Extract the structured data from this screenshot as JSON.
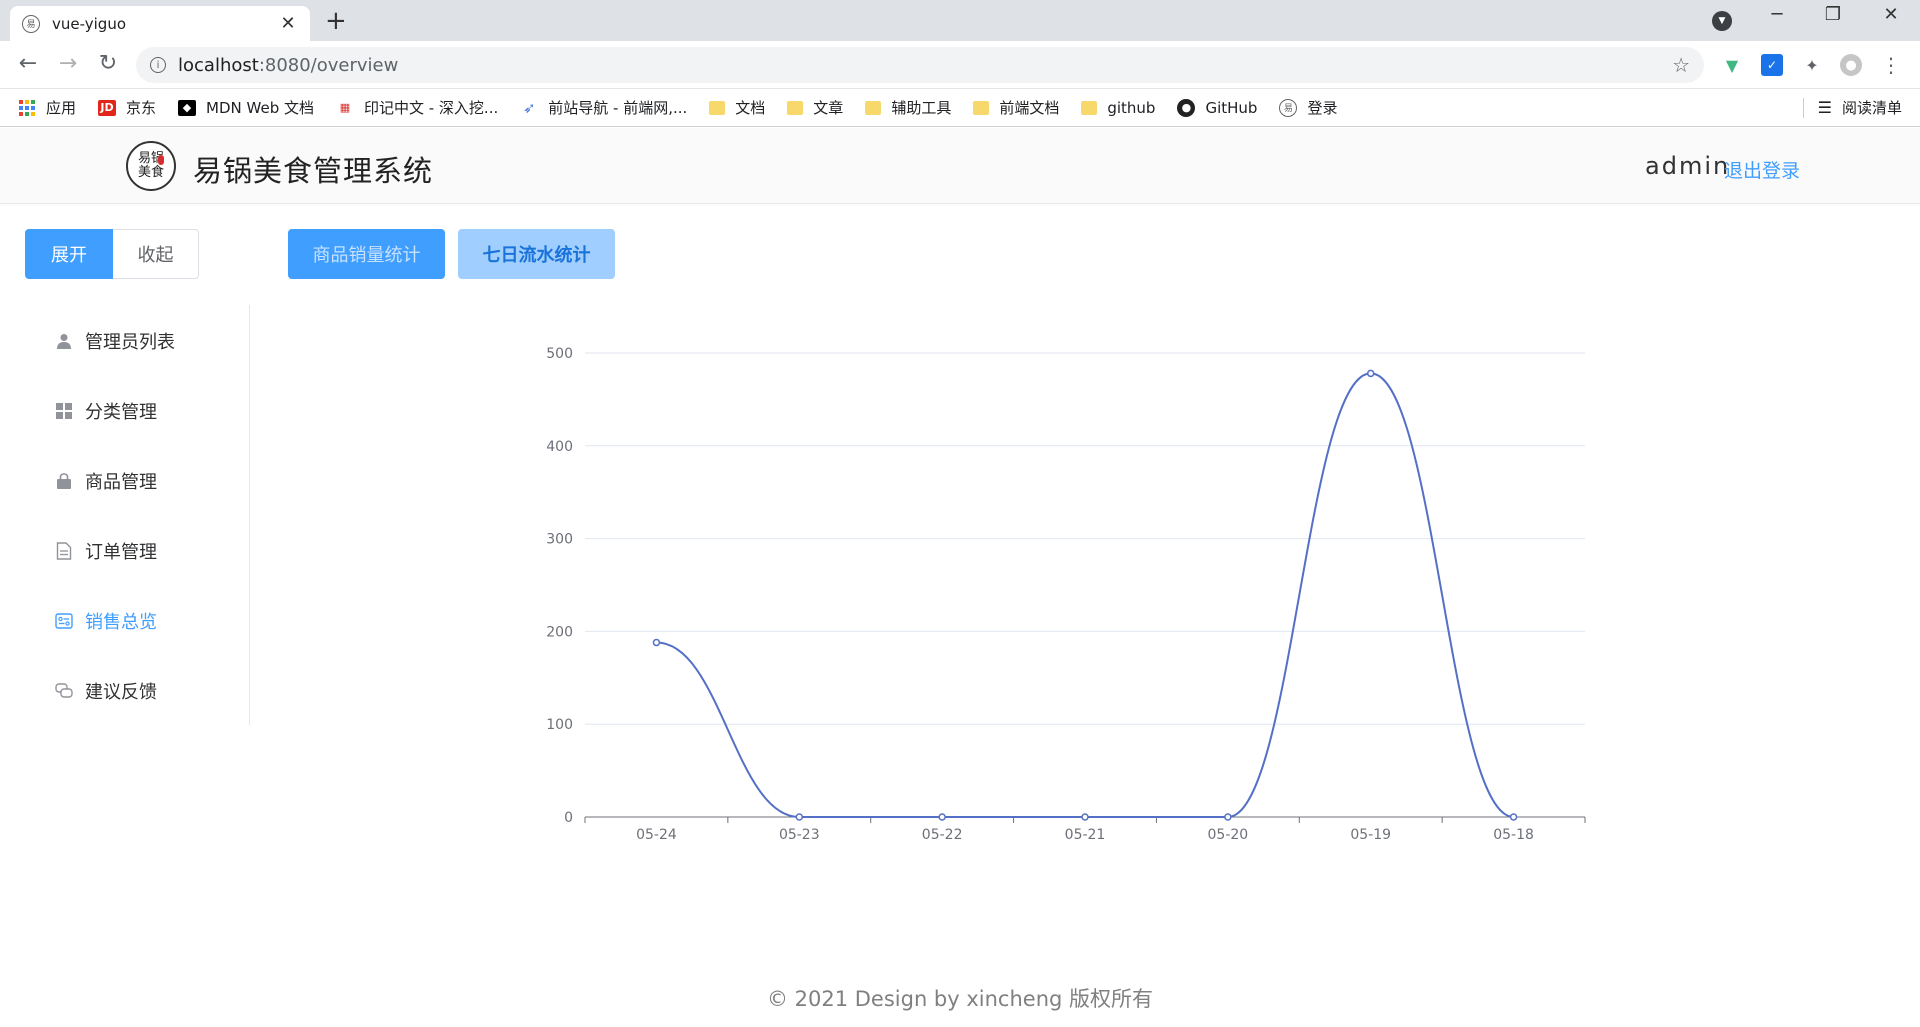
{
  "browser": {
    "tab_title": "vue-yiguo",
    "url_host": "localhost",
    "url_path": ":8080/overview",
    "bookmarks": [
      {
        "label": "应用",
        "icon": "apps-grid-icon"
      },
      {
        "label": "京东",
        "icon": "jd-logo-icon"
      },
      {
        "label": "MDN Web 文档",
        "icon": "mdn-logo-icon"
      },
      {
        "label": "印记中文 - 深入挖...",
        "icon": "yinji-logo-icon"
      },
      {
        "label": "前站导航 - 前端网,...",
        "icon": "rocket-icon"
      },
      {
        "label": "文档",
        "icon": "folder-icon"
      },
      {
        "label": "文章",
        "icon": "folder-icon"
      },
      {
        "label": "辅助工具",
        "icon": "folder-icon"
      },
      {
        "label": "前端文档",
        "icon": "folder-icon"
      },
      {
        "label": "github",
        "icon": "folder-icon"
      },
      {
        "label": "GitHub",
        "icon": "github-icon"
      },
      {
        "label": "登录",
        "icon": "site-logo-icon"
      }
    ],
    "reading_list": "阅读清单"
  },
  "header": {
    "logo_text_top": "易锅",
    "logo_text_bottom": "美食",
    "title": "易锅美食管理系统",
    "user": "admin",
    "logout": "退出登录"
  },
  "sidebar": {
    "expand": "展开",
    "collapse": "收起",
    "items": [
      {
        "label": "管理员列表",
        "icon": "user-icon"
      },
      {
        "label": "分类管理",
        "icon": "grid-icon"
      },
      {
        "label": "商品管理",
        "icon": "shopping-bag-icon"
      },
      {
        "label": "订单管理",
        "icon": "document-icon"
      },
      {
        "label": "销售总览",
        "icon": "data-board-icon"
      },
      {
        "label": "建议反馈",
        "icon": "chat-icon"
      }
    ],
    "active_index": 4
  },
  "stats_tabs": {
    "sales": "商品销量统计",
    "flow": "七日流水统计"
  },
  "chart_data": {
    "type": "line",
    "categories": [
      "05-24",
      "05-23",
      "05-22",
      "05-21",
      "05-20",
      "05-19",
      "05-18"
    ],
    "values": [
      188,
      0,
      0,
      0,
      0,
      478,
      0
    ],
    "ylim": [
      0,
      500
    ],
    "yticks": [
      0,
      100,
      200,
      300,
      400,
      500
    ],
    "smooth": true,
    "grid": true,
    "color": "#5470c6"
  },
  "footer": "© 2021 Design by xincheng 版权所有",
  "colors": {
    "primary": "#409eff",
    "primary_light": "#a0cfff"
  }
}
